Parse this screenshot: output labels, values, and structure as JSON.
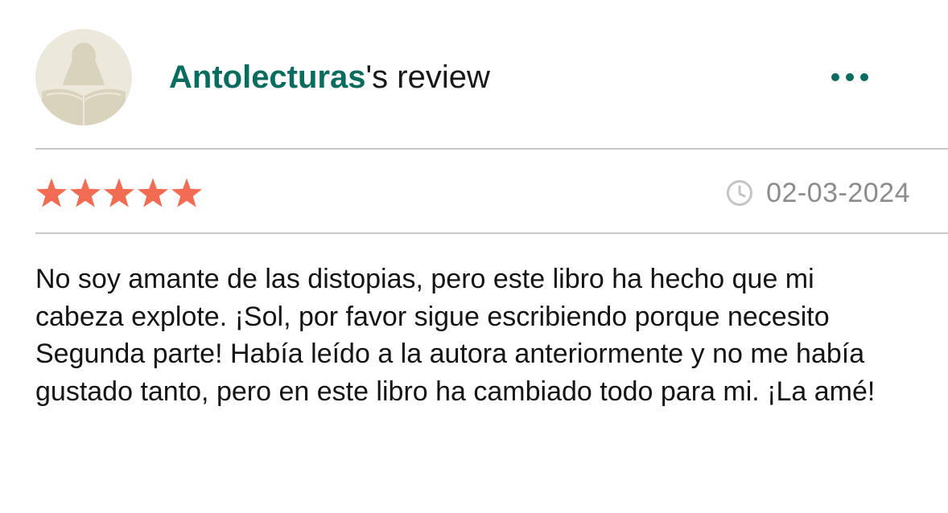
{
  "review": {
    "username": "Antolecturas",
    "title_suffix": "'s review",
    "rating": 5,
    "max_rating": 5,
    "date": "02-03-2024",
    "body": "No soy amante de las distopias, pero este libro ha hecho que mi cabeza explote. ¡Sol, por favor sigue escribiendo porque necesito Segunda parte! Había leído a la autora anteriormente y no me había gustado tanto, pero en este libro ha cambiado todo para mi. ¡La amé!"
  },
  "icons": {
    "avatar": "reader-silhouette-avatar-icon",
    "more": "more-horizontal-icon",
    "date": "clock-icon",
    "star": "star-icon"
  },
  "colors": {
    "username": "#0a6b5f",
    "more_dots": "#0a6b5f",
    "star": "#f26b53",
    "date": "#8c8c8c",
    "divider": "#c8c8c8",
    "avatar_bg": "#ece8dc",
    "avatar_figure": "#d9d2bc"
  }
}
